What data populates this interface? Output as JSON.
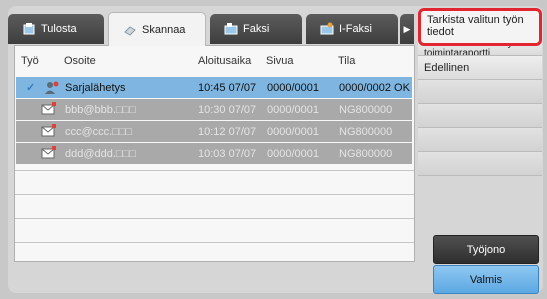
{
  "tabs": [
    {
      "label": "Tulosta",
      "icon": "print-icon",
      "active": false
    },
    {
      "label": "Skannaa",
      "icon": "scan-icon",
      "active": true
    },
    {
      "label": "Faksi",
      "icon": "fax-icon",
      "active": false
    },
    {
      "label": "I-Faksi",
      "icon": "ifax-icon",
      "active": false
    }
  ],
  "table": {
    "columns": [
      "Työ",
      "Osoite",
      "Aloitusaika",
      "Sivua",
      "Tila"
    ],
    "rows": [
      {
        "address": "Sarjalähetys",
        "time": "10:45 07/07",
        "pages": "0000/0001",
        "status": "0000/0002 OK",
        "selected": true
      },
      {
        "address": "bbb@bbb.□□□",
        "time": "10:30 07/07",
        "pages": "0000/0001",
        "status": "NG800000",
        "selected": false
      },
      {
        "address": "ccc@ccc.□□□",
        "time": "10:12 07/07",
        "pages": "0000/0001",
        "status": "NG800000",
        "selected": false
      },
      {
        "address": "ddd@ddd.□□□",
        "time": "10:03 07/07",
        "pages": "0000/0001",
        "status": "NG800000",
        "selected": false
      }
    ]
  },
  "menu": {
    "items": [
      "Tarkista valitun työn tiedot",
      "Tulosta kuvanlähetyksen toimintaraportti",
      "Edellinen"
    ]
  },
  "buttons": {
    "job_queue": "Työjono",
    "done": "Valmis"
  },
  "colors": {
    "selected_row": "#7fb6e1",
    "highlight_border": "#e2262f",
    "done_button": "#6fb4e9"
  }
}
